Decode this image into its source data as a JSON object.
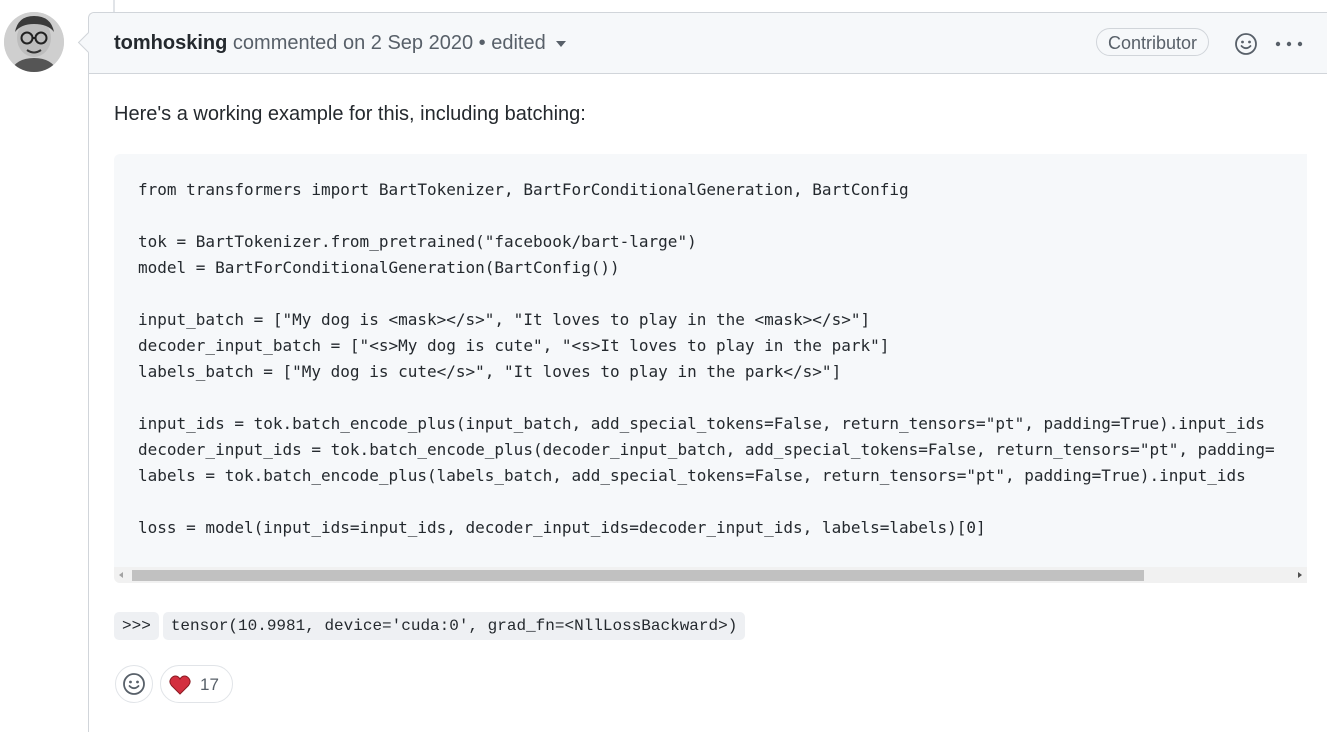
{
  "comment": {
    "author": "tomhosking",
    "action": "commented on",
    "date": "2 Sep 2020",
    "separator": "•",
    "edited_label": "edited",
    "role_badge": "Contributor",
    "body_text": "Here's a working example for this, including batching:",
    "code_lines": [
      "from transformers import BartTokenizer, BartForConditionalGeneration, BartConfig",
      "",
      "tok = BartTokenizer.from_pretrained(\"facebook/bart-large\")",
      "model = BartForConditionalGeneration(BartConfig())",
      "",
      "input_batch = [\"My dog is <mask></s>\", \"It loves to play in the <mask></s>\"]",
      "decoder_input_batch = [\"<s>My dog is cute\", \"<s>It loves to play in the park\"]",
      "labels_batch = [\"My dog is cute</s>\", \"It loves to play in the park</s>\"]",
      "",
      "input_ids = tok.batch_encode_plus(input_batch, add_special_tokens=False, return_tensors=\"pt\", padding=True).input_ids",
      "decoder_input_ids = tok.batch_encode_plus(decoder_input_batch, add_special_tokens=False, return_tensors=\"pt\", padding=",
      "labels = tok.batch_encode_plus(labels_batch, add_special_tokens=False, return_tensors=\"pt\", padding=True).input_ids",
      "",
      "loss = model(input_ids=input_ids, decoder_input_ids=decoder_input_ids, labels=labels)[0]"
    ],
    "output_prompt": ">>>",
    "output_value": "tensor(10.9981, device='cuda:0', grad_fn=<NllLossBackward>)",
    "reactions": {
      "heart_count": "17"
    }
  },
  "colors": {
    "text_primary": "#24292e",
    "text_muted": "#586069",
    "border": "#d1d5da",
    "code_background": "#f6f8fa",
    "heart": "#d32f3f"
  },
  "icons": {
    "avatar": "avatar",
    "header_reaction": "smiley-icon",
    "header_more": "kebab-horizontal-icon",
    "add_reaction": "smiley-icon",
    "heart_reaction": "heart-icon",
    "edited_dropdown": "triangle-down-icon"
  }
}
